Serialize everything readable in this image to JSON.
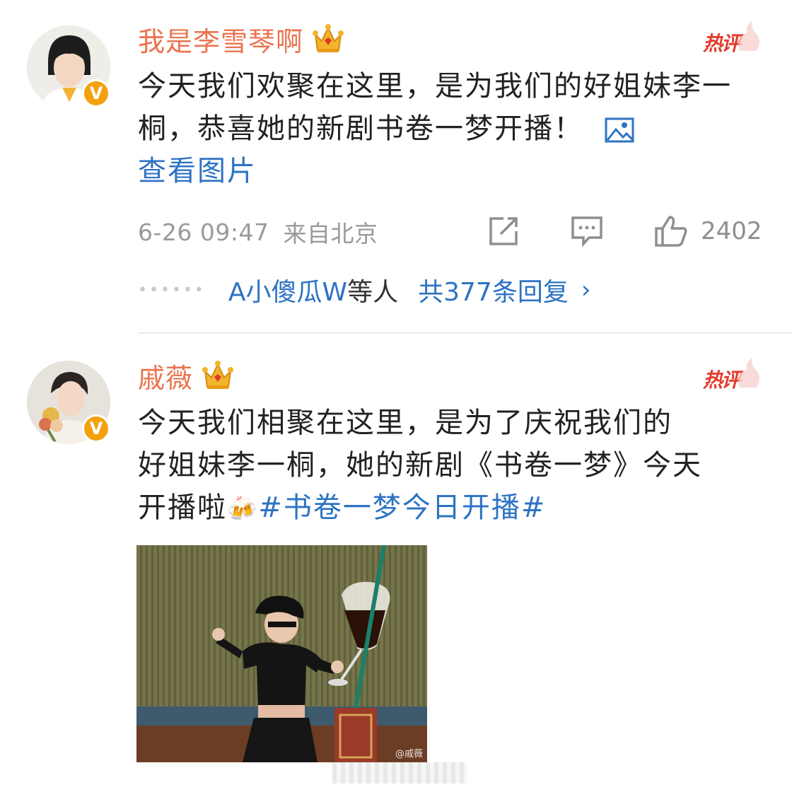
{
  "comments": [
    {
      "username": "我是李雪琴啊",
      "verified": "V",
      "hot_label": "热评",
      "text": "今天我们欢聚在这里，是为我们的好姐妹李一桐，恭喜她的新剧书卷一梦开播！",
      "view_image": "查看图片",
      "timestamp": "6-26 09:47",
      "location": "来自北京",
      "like_count": "2402",
      "reply_users": "A小傻瓜W",
      "reply_others": "等人",
      "reply_total": "共377条回复",
      "reply_chevron": "›"
    },
    {
      "username": "戚薇",
      "verified": "V",
      "hot_label": "热评",
      "text_line1": "今天我们相聚在这里，是为了庆祝我们的",
      "text_line2": "好姐妹李一桐，她的新剧《书卷一梦》今天",
      "text_line3": "开播啦",
      "emoji": "🍻",
      "hashtag": "#书卷一梦今日开播#",
      "photo_watermark": "@戚薇"
    }
  ],
  "colors": {
    "username": "#eb7350",
    "link": "#2e73c4",
    "hot": "#e33b2e",
    "badge": "#f3a10f"
  },
  "icons": [
    "crown-icon",
    "verified-icon",
    "hot-comment-icon",
    "image-icon",
    "repost-icon",
    "comment-icon",
    "like-icon"
  ]
}
